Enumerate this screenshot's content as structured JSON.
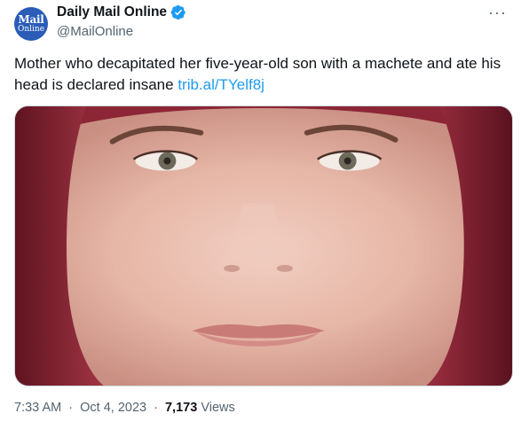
{
  "account": {
    "display_name": "Daily Mail Online",
    "handle": "@MailOnline",
    "logo_line1": "Mail",
    "logo_line2": "Online",
    "verified_icon": "verified-badge-icon"
  },
  "tweet": {
    "text": "Mother who decapitated her five-year-old son with a machete and ate his head is declared insane",
    "link": "trib.al/TYelf8j",
    "image_icon": "photo-of-woman-face"
  },
  "meta": {
    "time": "7:33 AM",
    "separator": "·",
    "date": "Oct 4, 2023",
    "views_count": "7,173",
    "views_label": "Views"
  },
  "menu_icon": "more-options-icon",
  "colors": {
    "link": "#1d9bf0",
    "secondary": "#536471",
    "verified": "#1d9bf0",
    "avatar_bg": "#2a5cb8"
  }
}
